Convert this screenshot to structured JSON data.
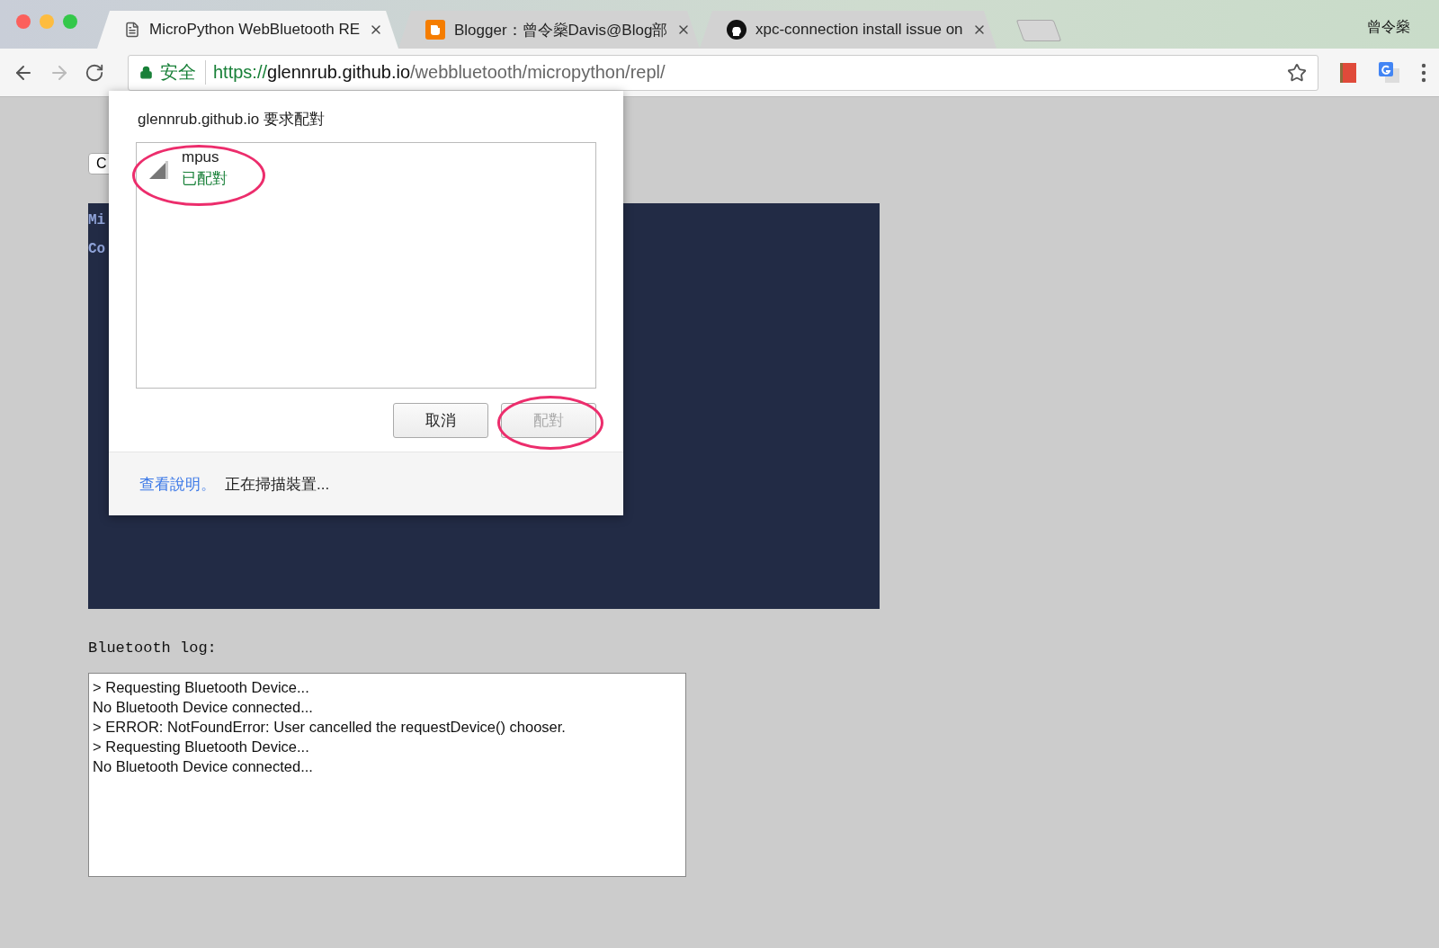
{
  "browser": {
    "tabs": [
      {
        "title": "MicroPython WebBluetooth RE",
        "selected": true
      },
      {
        "title": "Blogger：曾令燊Davis@Blog部",
        "selected": false
      },
      {
        "title": "xpc-connection install issue on",
        "selected": false
      }
    ],
    "profile": "曾令燊",
    "address": {
      "security": "安全",
      "scheme": "https://",
      "host": "glennrub.github.io",
      "path": "/webbluetooth/micropython/repl/"
    }
  },
  "page": {
    "connect_button": "C",
    "terminal_lines": [
      "Mi",
      "Co"
    ],
    "log_label": "Bluetooth log:",
    "log_lines": [
      "> Requesting Bluetooth Device...",
      "No Bluetooth Device connected...",
      "> ERROR: NotFoundError: User cancelled the requestDevice() chooser.",
      "> Requesting Bluetooth Device...",
      "No Bluetooth Device connected..."
    ]
  },
  "dialog": {
    "title": "glennrub.github.io 要求配對",
    "devices": [
      {
        "name": "mpus",
        "status": "已配對",
        "selected": false
      }
    ],
    "buttons": [
      {
        "label": "取消",
        "disabled": false
      },
      {
        "label": "配對",
        "disabled": true
      }
    ],
    "help_link": "查看說明。",
    "status": "正在掃描裝置..."
  }
}
